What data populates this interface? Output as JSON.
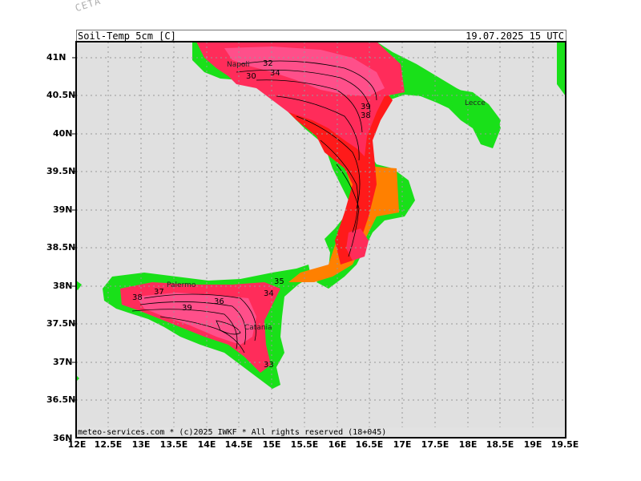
{
  "corner_text": "CETA - m...",
  "header": {
    "variable": "Soil-Temp_5cm_[C]",
    "valid_time": "19.07.2025  15 UTC"
  },
  "footer": "meteo-services.com * (c)2025 IWKF * All rights reserved (18+045)",
  "axes": {
    "lat_labels": [
      "41N",
      "40.5N",
      "40N",
      "39.5N",
      "39N",
      "38.5N",
      "38N",
      "37.5N",
      "37N",
      "36.5N",
      "36N"
    ],
    "lon_labels": [
      "12E",
      "12.5E",
      "13E",
      "13.5E",
      "14E",
      "14.5E",
      "15E",
      "15.5E",
      "16E",
      "16.5E",
      "17E",
      "17.5E",
      "18E",
      "18.5E",
      "19E",
      "19.5E"
    ]
  },
  "places": [
    "Napoli",
    "Lecce",
    "Palermo",
    "Catania"
  ],
  "contour_labels": {
    "napoli_32": "32",
    "napoli_30": "30",
    "napoli_34": "34",
    "puglia_39": "39",
    "puglia_38": "38",
    "sicily_38": "38",
    "sicily_37": "37",
    "sicily_39": "39",
    "sicily_36": "36",
    "sicily_34": "34",
    "sicily_35": "35",
    "sicily_33": "33"
  },
  "colors": {
    "sea": "#e0e0e0",
    "land_cool": "#19e019",
    "band_orange": "#ff8000",
    "band_red": "#ff1a1a",
    "band_hot": "#ff2c5a",
    "band_hottest": "#ff4f8a",
    "grid": "#999999"
  }
}
